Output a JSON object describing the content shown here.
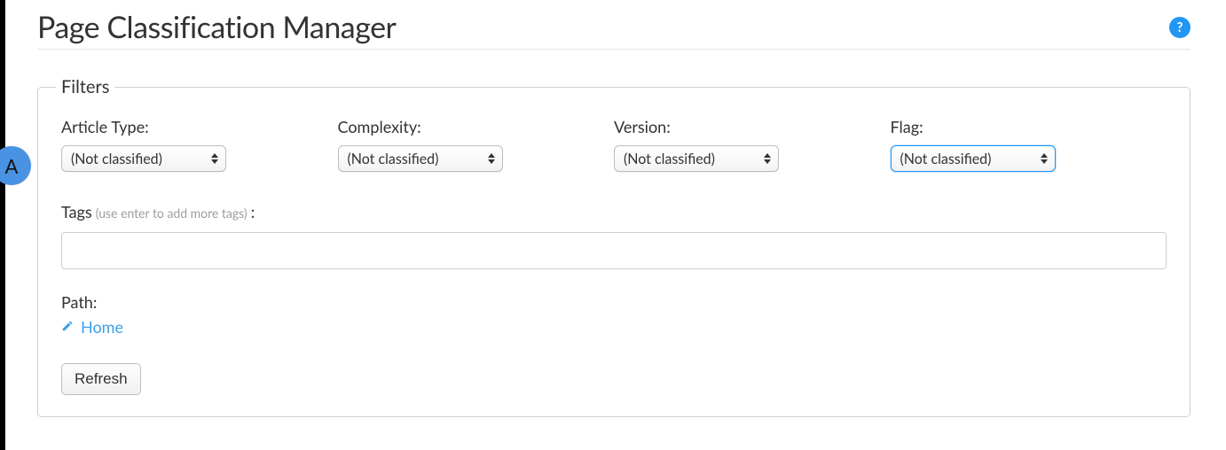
{
  "header": {
    "title": "Page Classification Manager",
    "help_symbol": "?"
  },
  "filters": {
    "legend": "Filters",
    "article_type": {
      "label": "Article Type:",
      "selected": "(Not classified)"
    },
    "complexity": {
      "label": "Complexity:",
      "selected": "(Not classified)"
    },
    "version": {
      "label": "Version:",
      "selected": "(Not classified)"
    },
    "flag": {
      "label": "Flag:",
      "selected": "(Not classified)"
    },
    "tags": {
      "label": "Tags",
      "hint": "(use enter to add more tags)",
      "colon": ":",
      "value": ""
    },
    "path": {
      "label": "Path:",
      "link_text": "Home"
    },
    "refresh_label": "Refresh"
  },
  "callout": {
    "letter": "A"
  }
}
